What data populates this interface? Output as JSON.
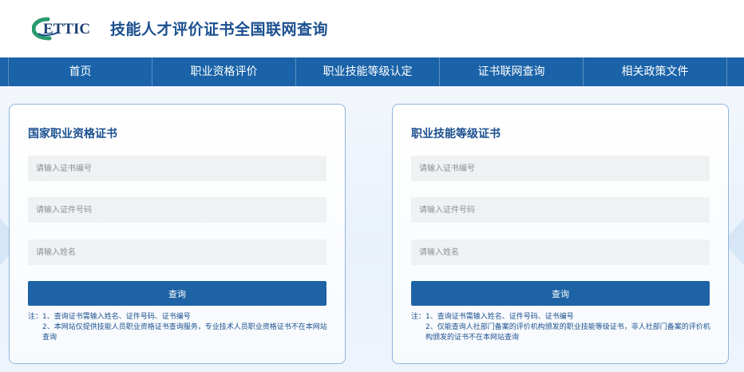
{
  "header": {
    "logo_text": "ETTIC",
    "site_title": "技能人才评价证书全国联网查询"
  },
  "nav": {
    "items": [
      "首页",
      "职业资格评价",
      "职业技能等级认定",
      "证书联网查询",
      "相关政策文件"
    ]
  },
  "cards": [
    {
      "title": "国家职业资格证书",
      "fields": {
        "cert_no_placeholder": "请输入证书编号",
        "id_no_placeholder": "请输入证件号码",
        "name_placeholder": "请输入姓名"
      },
      "button_label": "查询",
      "notes": {
        "line1": "注：1、查询证书需输入姓名、证件号码、证书编号",
        "line2": "2、本网站仅提供技能人员职业资格证书查询服务，专业技术人员职业资格证书不在本网站查询"
      }
    },
    {
      "title": "职业技能等级证书",
      "fields": {
        "cert_no_placeholder": "请输入证书编号",
        "id_no_placeholder": "请输入证件号码",
        "name_placeholder": "请输入姓名"
      },
      "button_label": "查询",
      "notes": {
        "line1": "注：1、查询证书需输入姓名、证件号码、证书编号",
        "line2": "2、仅能查询人社部门备案的评价机构颁发的职业技能等级证书，非人社部门备案的评价机构颁发的证书不在本网站查询"
      }
    }
  ],
  "colors": {
    "nav_bg": "#1a63a8",
    "title_blue": "#1b4f8f",
    "button_bg": "#1e63a5",
    "logo_green": "#2a9b6e",
    "card_border": "#8fb5dc"
  },
  "icons": {
    "logo": "ettic-logo"
  }
}
